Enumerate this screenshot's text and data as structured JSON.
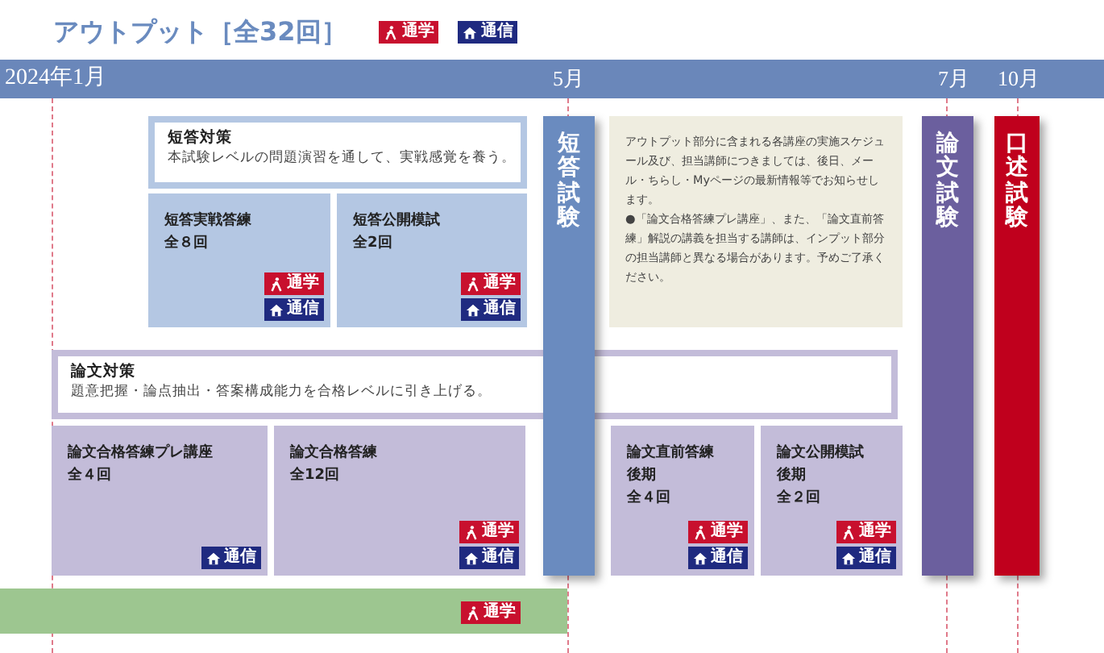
{
  "title": "アウトプット［全32回］",
  "legend": [
    {
      "kind": "commute",
      "label": "通学"
    },
    {
      "kind": "correspondence",
      "label": "通信"
    }
  ],
  "timeline": {
    "months": [
      "2024年1月",
      "5月",
      "7月",
      "10月"
    ]
  },
  "short_answer": {
    "heading": "短答対策",
    "description": "本試験レベルの問題演習を通して、実戦感覚を養う。",
    "courses": [
      {
        "name": "短答実戦答練",
        "count": "全８回",
        "badges": [
          {
            "kind": "commute",
            "label": "通学"
          },
          {
            "kind": "correspondence",
            "label": "通信"
          }
        ]
      },
      {
        "name": "短答公開模試",
        "count": "全2回",
        "badges": [
          {
            "kind": "commute",
            "label": "通学"
          },
          {
            "kind": "correspondence",
            "label": "通信"
          }
        ]
      }
    ]
  },
  "exams": [
    {
      "label": "短答試験",
      "color": "#6a8bbf"
    },
    {
      "label": "論文試験",
      "color": "#6b5f9e"
    },
    {
      "label": "口述試験",
      "color": "#c0001d"
    }
  ],
  "note": [
    "アウトプット部分に含まれる各講座の実施スケジュール及び、担当講師につきましては、後日、メール・ちらし・Myページの最新情報等でお知らせします。",
    "●「論文合格答練プレ講座」、また、「論文直前答練」解説の講義を担当する講師は、インプット部分の担当講師と異なる場合があります。予めご了承ください。"
  ],
  "essay": {
    "heading": "論文対策",
    "description": "題意把握・論点抽出・答案構成能力を合格レベルに引き上げる。",
    "courses": [
      {
        "name": "論文合格答練プレ講座",
        "count": "全４回",
        "badges": [
          {
            "kind": "correspondence",
            "label": "通信"
          }
        ]
      },
      {
        "name": "論文合格答練",
        "count": "全12回",
        "badges": [
          {
            "kind": "commute",
            "label": "通学"
          },
          {
            "kind": "correspondence",
            "label": "通信"
          }
        ]
      },
      {
        "name": "論文直前答練",
        "term": "後期",
        "count": "全４回",
        "badges": [
          {
            "kind": "commute",
            "label": "通学"
          },
          {
            "kind": "correspondence",
            "label": "通信"
          }
        ]
      },
      {
        "name": "論文公開模試",
        "term": "後期",
        "count": "全２回",
        "badges": [
          {
            "kind": "commute",
            "label": "通学"
          },
          {
            "kind": "correspondence",
            "label": "通信"
          }
        ]
      }
    ]
  },
  "bottom_bar": {
    "badges": [
      {
        "kind": "commute",
        "label": "通学"
      }
    ]
  }
}
